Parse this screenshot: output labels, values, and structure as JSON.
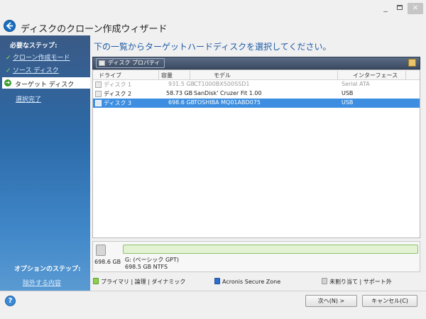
{
  "window": {
    "title": "ディスクのクローン作成ウィザード",
    "controls": {
      "minimize": "_",
      "close": "×"
    }
  },
  "nav": {
    "required_heading": "必要なステップ:",
    "steps": [
      {
        "label": "クローン作成モード",
        "state": "done"
      },
      {
        "label": "ソース ディスク",
        "state": "done"
      },
      {
        "label": "ターゲット ディスク",
        "state": "current"
      },
      {
        "label": "選択完了",
        "state": "pending"
      }
    ],
    "optional_heading": "オプションのステップ:",
    "optional_link": "除外する内容"
  },
  "main": {
    "instruction": "下の一覧からターゲットハードディスクを選択してください。",
    "toolbar": {
      "properties_button": "ディスク プロパティ"
    },
    "table": {
      "columns": [
        "ドライブ",
        "容量",
        "モデル",
        "インターフェース"
      ],
      "rows": [
        {
          "drive": "ディスク 1",
          "capacity": "931.5 GB",
          "model": "CT1000BX500SSD1",
          "interface": "Serial ATA",
          "state": "disabled"
        },
        {
          "drive": "ディスク 2",
          "capacity": "58.73 GB",
          "model": "SanDisk' Cruzer Fit 1.00",
          "interface": "USB",
          "state": "normal"
        },
        {
          "drive": "ディスク 3",
          "capacity": "698.6 GB",
          "model": "TOSHIBA MQ01ABD075",
          "interface": "USB",
          "state": "selected"
        }
      ]
    },
    "disk_map": {
      "size": "698.6 GB",
      "partition_line1": "G: (ベーシック GPT)",
      "partition_line2": "698.5 GB  NTFS"
    },
    "legend": {
      "primary": "プライマリ | 論理 | ダイナミック",
      "acronis": "Acronis Secure Zone",
      "unallocated": "未割り当て | サポート外"
    }
  },
  "footer": {
    "next_button": "次へ(N) >",
    "cancel_button": "キャンセル(C)"
  },
  "colors": {
    "accent_blue": "#3d8ee0",
    "nav_gradient_top": "#3a5a86",
    "check_green": "#8be05a",
    "partition_green": "#e4f2d4"
  }
}
